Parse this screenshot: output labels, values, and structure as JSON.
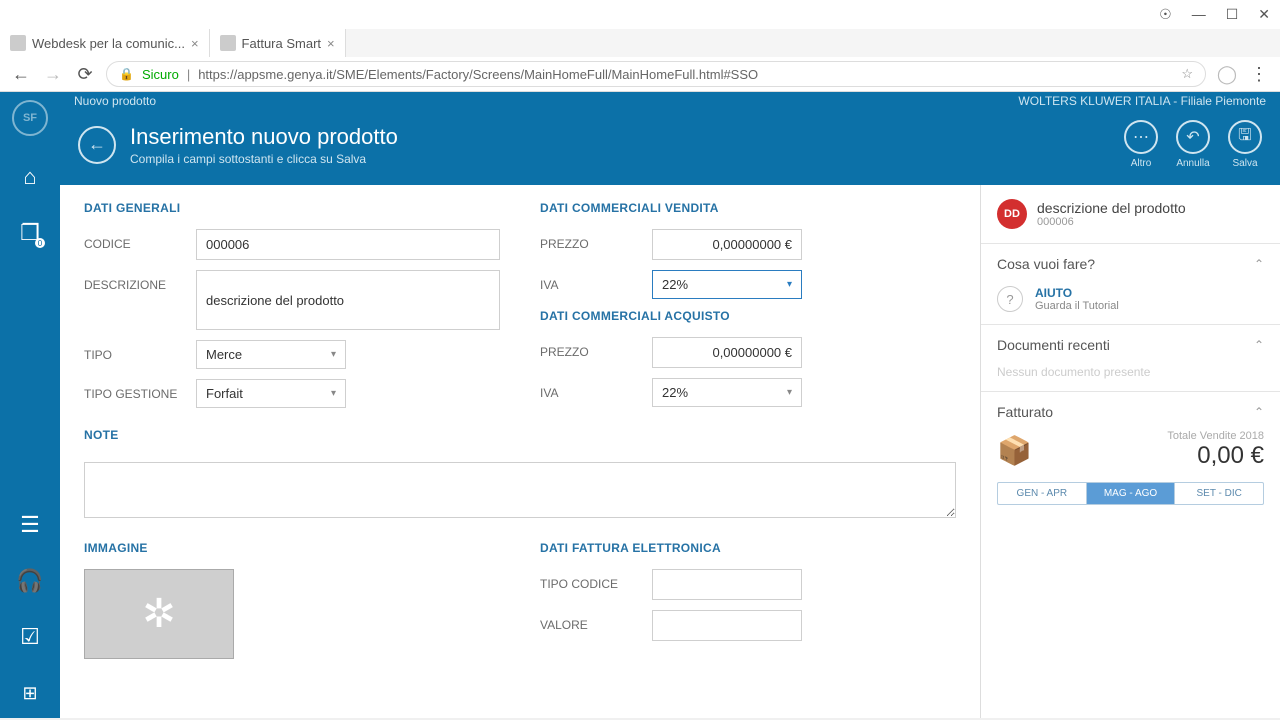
{
  "browser": {
    "tabs": [
      {
        "title": "Webdesk per la comunic..."
      },
      {
        "title": "Fattura Smart"
      }
    ],
    "secure_label": "Sicuro",
    "url": "https://appsme.genya.it/SME/Elements/Factory/Screens/MainHomeFull/MainHomeFull.html#SSO"
  },
  "sidebar": {
    "badge": "SF"
  },
  "bluebar": {
    "left": "Nuovo prodotto",
    "right": "WOLTERS KLUWER ITALIA - Filiale Piemonte"
  },
  "header": {
    "title": "Inserimento nuovo prodotto",
    "subtitle": "Compila i campi sottostanti e clicca su Salva",
    "actions": {
      "altro": "Altro",
      "annulla": "Annulla",
      "salva": "Salva"
    }
  },
  "form": {
    "sect_gen": "DATI GENERALI",
    "sect_vend": "DATI COMMERCIALI VENDITA",
    "sect_acq": "DATI COMMERCIALI ACQUISTO",
    "sect_note": "NOTE",
    "sect_img": "IMMAGINE",
    "sect_fatt": "DATI FATTURA ELETTRONICA",
    "labels": {
      "codice": "CODICE",
      "descrizione": "DESCRIZIONE",
      "tipo": "TIPO",
      "tipo_gestione": "TIPO GESTIONE",
      "prezzo": "PREZZO",
      "iva": "IVA",
      "tipo_codice": "TIPO CODICE",
      "valore": "VALORE"
    },
    "values": {
      "codice": "000006",
      "descrizione": "descrizione del prodotto",
      "tipo": "Merce",
      "tipo_gestione": "Forfait",
      "prezzo_vend": "0,00000000 €",
      "iva_vend": "22%",
      "prezzo_acq": "0,00000000 €",
      "iva_acq": "22%"
    }
  },
  "right": {
    "prod_title": "descrizione del prodotto",
    "prod_code": "000006",
    "dd": "DD",
    "cosa": "Cosa vuoi fare?",
    "aiuto": "AIUTO",
    "aiuto_sub": "Guarda il Tutorial",
    "doc_title": "Documenti recenti",
    "doc_empty": "Nessun documento presente",
    "fat_title": "Fatturato",
    "fat_label": "Totale Vendite 2018",
    "fat_amount": "0,00 €",
    "seg": {
      "a": "GEN - APR",
      "b": "MAG - AGO",
      "c": "SET - DIC"
    }
  }
}
